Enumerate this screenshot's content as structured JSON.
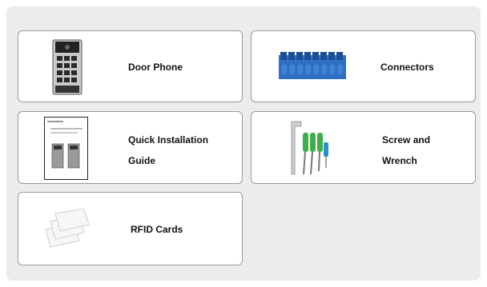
{
  "items": [
    {
      "label_lines": [
        "Door Phone"
      ]
    },
    {
      "label_lines": [
        "Connectors"
      ]
    },
    {
      "label_lines": [
        "Quick Installation",
        "Guide"
      ]
    },
    {
      "label_lines": [
        "Screw and",
        "Wrench"
      ]
    },
    {
      "label_lines": [
        "RFID Cards"
      ]
    }
  ]
}
